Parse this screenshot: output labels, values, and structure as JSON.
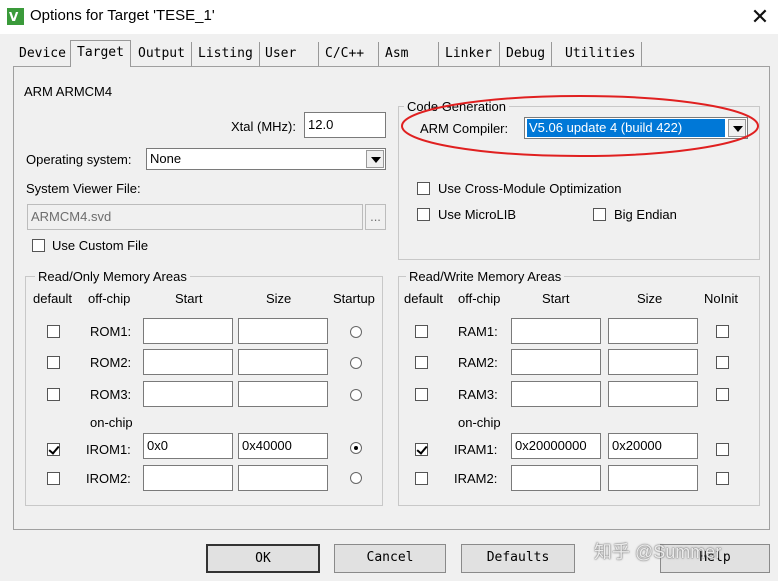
{
  "window": {
    "title": "Options for Target 'TESE_1'",
    "close_glyph": "✕"
  },
  "tabs": [
    {
      "label": "Device"
    },
    {
      "label": "Target"
    },
    {
      "label": "Output"
    },
    {
      "label": "Listing"
    },
    {
      "label": "User"
    },
    {
      "label": "C/C++"
    },
    {
      "label": "Asm"
    },
    {
      "label": "Linker"
    },
    {
      "label": "Debug"
    },
    {
      "label": "Utilities"
    }
  ],
  "target": {
    "device_name": "ARM ARMCM4",
    "xtal_label": "Xtal (MHz):",
    "xtal_value": "12.0",
    "os_label": "Operating system:",
    "os_value": "None",
    "svd_label": "System Viewer File:",
    "svd_value": "ARMCM4.svd",
    "svd_browse": "...",
    "use_custom_file": "Use Custom File"
  },
  "code_generation": {
    "title": "Code Generation",
    "compiler_label": "ARM Compiler:",
    "compiler_value": "V5.06 update 4 (build 422)",
    "cross_module": "Use Cross-Module Optimization",
    "microlib": "Use MicroLIB",
    "big_endian": "Big Endian",
    "highlight_color": "#e02020"
  },
  "ro_memory": {
    "title": "Read/Only Memory Areas",
    "headers": {
      "default": "default",
      "offchip": "off-chip",
      "start": "Start",
      "size": "Size",
      "startup": "Startup"
    },
    "onchip_label": "on-chip",
    "rows": [
      {
        "name": "ROM1:",
        "start": "",
        "size": "",
        "default": false,
        "startup": false
      },
      {
        "name": "ROM2:",
        "start": "",
        "size": "",
        "default": false,
        "startup": false
      },
      {
        "name": "ROM3:",
        "start": "",
        "size": "",
        "default": false,
        "startup": false
      },
      {
        "name": "IROM1:",
        "start": "0x0",
        "size": "0x40000",
        "default": true,
        "startup": true
      },
      {
        "name": "IROM2:",
        "start": "",
        "size": "",
        "default": false,
        "startup": false
      }
    ]
  },
  "rw_memory": {
    "title": "Read/Write Memory Areas",
    "headers": {
      "default": "default",
      "offchip": "off-chip",
      "start": "Start",
      "size": "Size",
      "noinit": "NoInit"
    },
    "onchip_label": "on-chip",
    "rows": [
      {
        "name": "RAM1:",
        "start": "",
        "size": "",
        "default": false,
        "noinit": false
      },
      {
        "name": "RAM2:",
        "start": "",
        "size": "",
        "default": false,
        "noinit": false
      },
      {
        "name": "RAM3:",
        "start": "",
        "size": "",
        "default": false,
        "noinit": false
      },
      {
        "name": "IRAM1:",
        "start": "0x20000000",
        "size": "0x20000",
        "default": true,
        "noinit": false
      },
      {
        "name": "IRAM2:",
        "start": "",
        "size": "",
        "default": false,
        "noinit": false
      }
    ]
  },
  "buttons": {
    "ok": "OK",
    "cancel": "Cancel",
    "defaults": "Defaults",
    "help": "Help"
  },
  "watermark": "知乎 @Summer"
}
